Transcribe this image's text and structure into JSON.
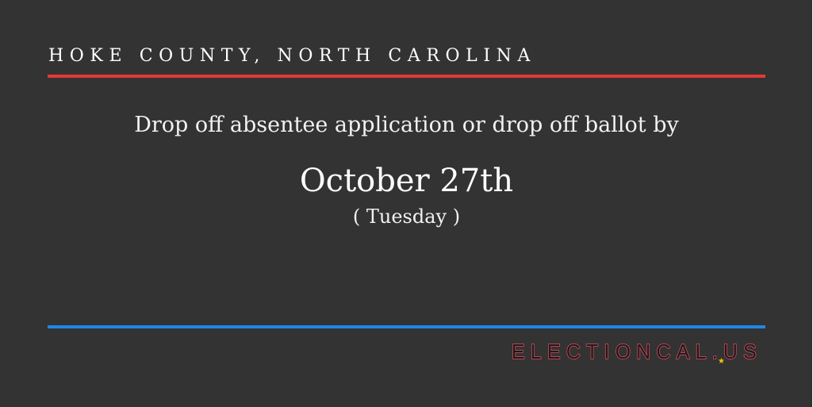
{
  "header": {
    "county": "HOKE COUNTY, NORTH CAROLINA"
  },
  "main": {
    "instruction": "Drop off absentee application or drop off ballot by",
    "date": "October 27th",
    "weekday": "( Tuesday )"
  },
  "footer": {
    "brand": "ELECTIONCAL.US",
    "brand_colors": {
      "primary": "#c94a5a",
      "outline": "#3b6fd6",
      "star": "#f2c500"
    }
  },
  "colors": {
    "background": "#333333",
    "top_rule": "#e53935",
    "bottom_rule": "#1e88e5"
  }
}
